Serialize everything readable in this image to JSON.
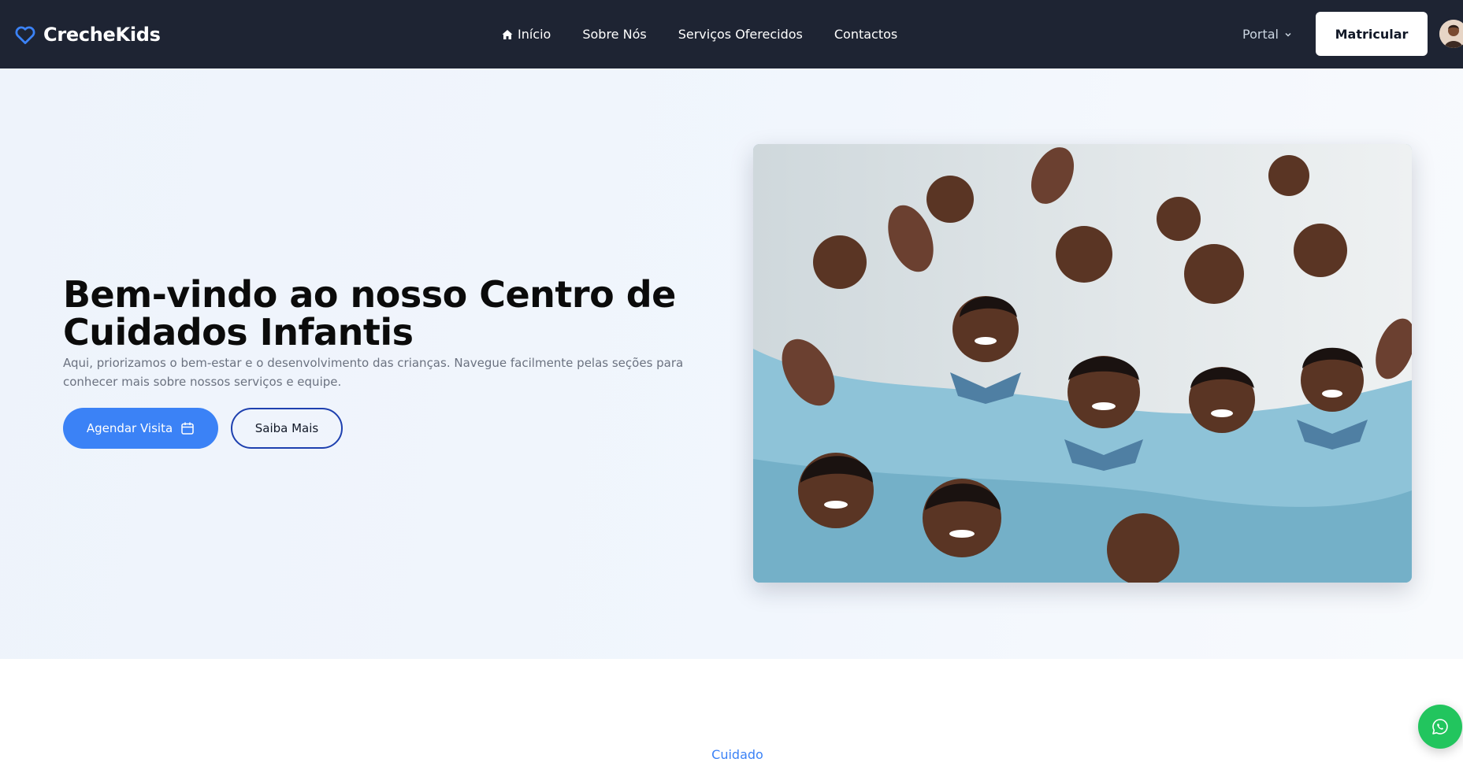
{
  "brand": {
    "name": "CrecheKids",
    "icon": "heart-outline-icon",
    "icon_color": "#3b82f6"
  },
  "nav": {
    "items": [
      {
        "label": "Início",
        "icon": "home-icon"
      },
      {
        "label": "Sobre Nós"
      },
      {
        "label": "Serviços Oferecidos"
      },
      {
        "label": "Contactos"
      }
    ],
    "portal_label": "Portal",
    "cta_label": "Matricular"
  },
  "hero": {
    "title": "Bem-vindo ao nosso Centro de Cuidados Infantis",
    "subtitle": "Aqui, priorizamos o bem-estar e o desenvolvimento das crianças. Navegue facilmente pelas seções para conhecer mais sobre nossos serviços e equipe.",
    "primary_button": "Agendar Visita",
    "secondary_button": "Saiba Mais"
  },
  "next_section": {
    "eyebrow": "Cuidado"
  },
  "colors": {
    "topbar": "#1e2433",
    "accent": "#3b82f6",
    "whatsapp": "#22c55e"
  }
}
